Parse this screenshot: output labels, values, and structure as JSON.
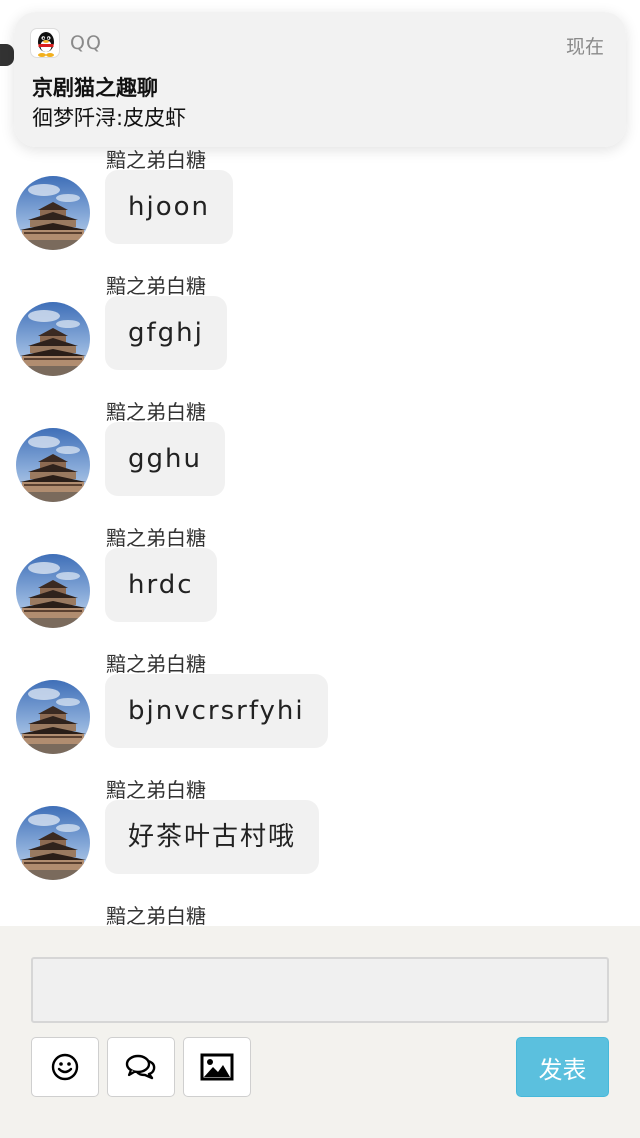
{
  "notification": {
    "app_name": "QQ",
    "time": "现在",
    "title": "京剧猫之趣聊",
    "body": "徊梦阡浔:皮皮虾"
  },
  "messages": [
    {
      "sender": "黯之弟白糖",
      "text": "hjoon"
    },
    {
      "sender": "黯之弟白糖",
      "text": "gfghj"
    },
    {
      "sender": "黯之弟白糖",
      "text": "gghu"
    },
    {
      "sender": "黯之弟白糖",
      "text": "hrdc"
    },
    {
      "sender": "黯之弟白糖",
      "text": "bjnvcrsrfyhi"
    },
    {
      "sender": "黯之弟白糖",
      "text": "好茶叶古村哦"
    },
    {
      "sender": "黯之弟白糖",
      "text": ""
    }
  ],
  "composer": {
    "input_value": "",
    "send_label": "发表",
    "send_color": "#5bc0de",
    "tools": [
      "smiley-icon",
      "chat-bubbles-icon",
      "image-icon"
    ]
  }
}
